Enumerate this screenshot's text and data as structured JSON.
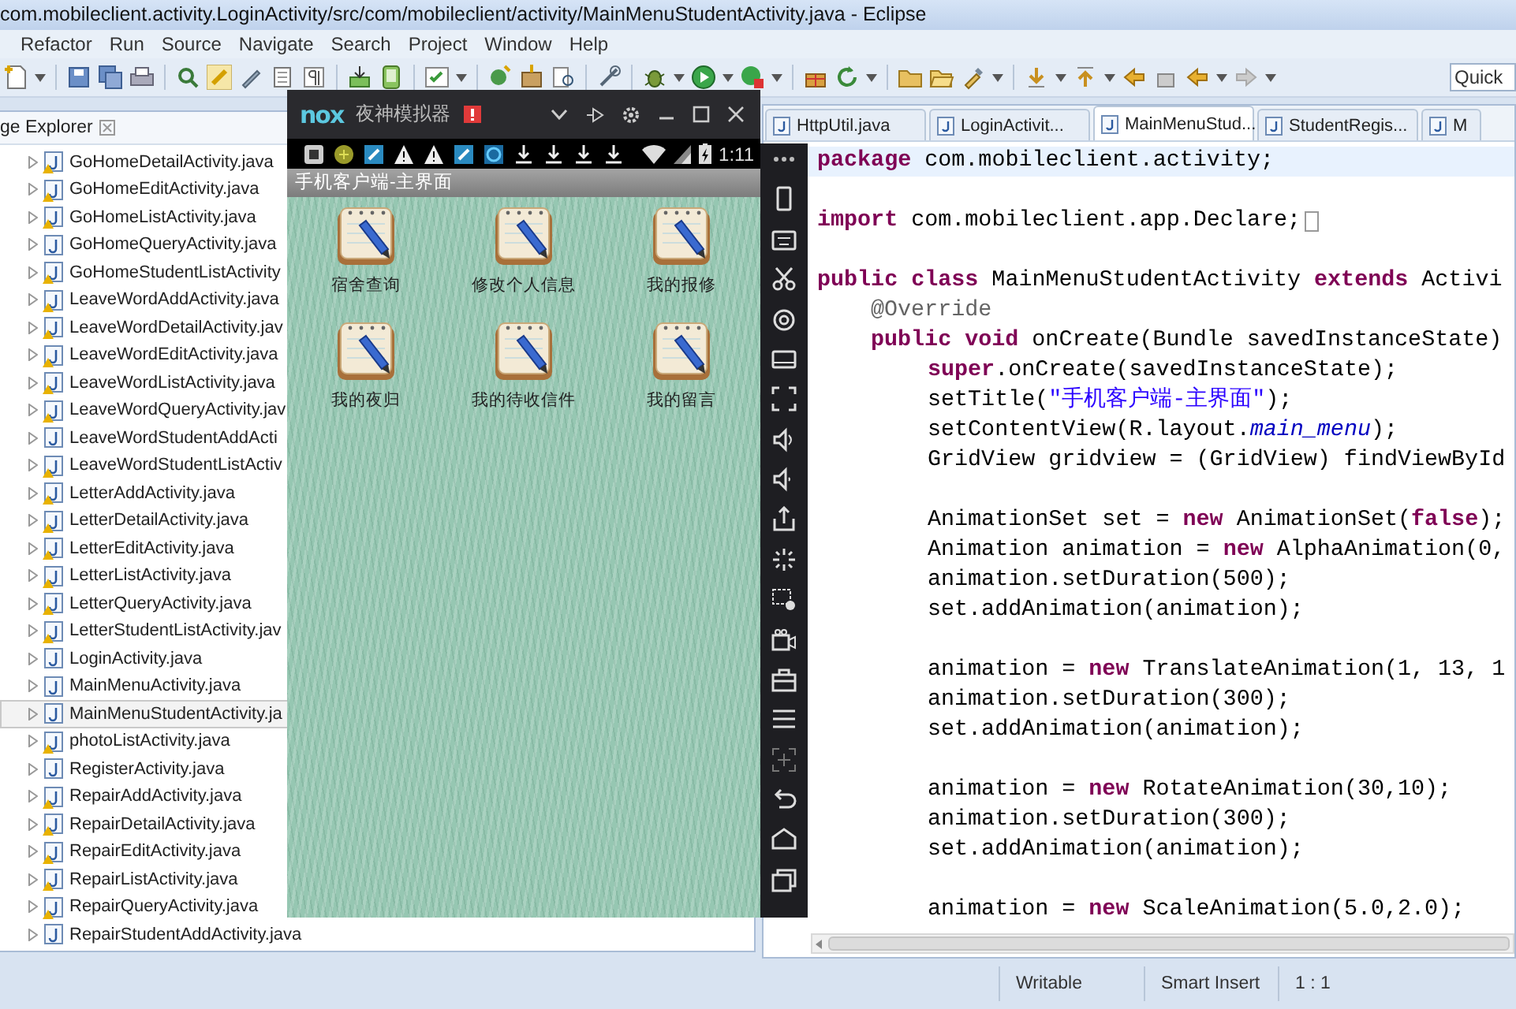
{
  "window": {
    "title": "com.mobileclient.activity.LoginActivity/src/com/mobileclient/activity/MainMenuStudentActivity.java - Eclipse"
  },
  "menu_bar": [
    "Refactor",
    "Run",
    "Source",
    "Navigate",
    "Search",
    "Project",
    "Window",
    "Help"
  ],
  "quick_access": {
    "placeholder": "Quick"
  },
  "package_explorer": {
    "title": "ge Explorer",
    "items": [
      {
        "label": "GoHomeDetailActivity.java",
        "warning": true,
        "selected": false
      },
      {
        "label": "GoHomeEditActivity.java",
        "warning": true,
        "selected": false
      },
      {
        "label": "GoHomeListActivity.java",
        "warning": true,
        "selected": false
      },
      {
        "label": "GoHomeQueryActivity.java",
        "warning": false,
        "selected": false
      },
      {
        "label": "GoHomeStudentListActivity",
        "warning": true,
        "selected": false
      },
      {
        "label": "LeaveWordAddActivity.java",
        "warning": true,
        "selected": false
      },
      {
        "label": "LeaveWordDetailActivity.jav",
        "warning": true,
        "selected": false
      },
      {
        "label": "LeaveWordEditActivity.java",
        "warning": true,
        "selected": false
      },
      {
        "label": "LeaveWordListActivity.java",
        "warning": true,
        "selected": false
      },
      {
        "label": "LeaveWordQueryActivity.jav",
        "warning": true,
        "selected": false
      },
      {
        "label": "LeaveWordStudentAddActi",
        "warning": false,
        "selected": false
      },
      {
        "label": "LeaveWordStudentListActiv",
        "warning": true,
        "selected": false
      },
      {
        "label": "LetterAddActivity.java",
        "warning": true,
        "selected": false
      },
      {
        "label": "LetterDetailActivity.java",
        "warning": true,
        "selected": false
      },
      {
        "label": "LetterEditActivity.java",
        "warning": true,
        "selected": false
      },
      {
        "label": "LetterListActivity.java",
        "warning": true,
        "selected": false
      },
      {
        "label": "LetterQueryActivity.java",
        "warning": true,
        "selected": false
      },
      {
        "label": "LetterStudentListActivity.jav",
        "warning": true,
        "selected": false
      },
      {
        "label": "LoginActivity.java",
        "warning": false,
        "selected": false
      },
      {
        "label": "MainMenuActivity.java",
        "warning": false,
        "selected": false
      },
      {
        "label": "MainMenuStudentActivity.ja",
        "warning": false,
        "selected": true
      },
      {
        "label": "photoListActivity.java",
        "warning": true,
        "selected": false
      },
      {
        "label": "RegisterActivity.java",
        "warning": false,
        "selected": false
      },
      {
        "label": "RepairAddActivity.java",
        "warning": true,
        "selected": false
      },
      {
        "label": "RepairDetailActivity.java",
        "warning": true,
        "selected": false
      },
      {
        "label": "RepairEditActivity.java",
        "warning": true,
        "selected": false
      },
      {
        "label": "RepairListActivity.java",
        "warning": true,
        "selected": false
      },
      {
        "label": "RepairQueryActivity.java",
        "warning": true,
        "selected": false
      },
      {
        "label": "RepairStudentAddActivity.java",
        "warning": false,
        "selected": false
      }
    ]
  },
  "editor": {
    "tabs": [
      {
        "label": "HttpUtil.java",
        "selected": false
      },
      {
        "label": "LoginActivit...",
        "selected": false
      },
      {
        "label": "MainMenuStud...",
        "selected": true
      },
      {
        "label": "StudentRegis...",
        "selected": false
      },
      {
        "label": "M",
        "selected": false
      }
    ],
    "lines": [
      {
        "kind": "top",
        "current": true,
        "folded": false,
        "tokens": [
          {
            "kind": "keyword",
            "text": "package"
          },
          {
            "kind": "plain",
            "text": " com.mobileclient.activity;"
          }
        ]
      },
      {
        "kind": "blank",
        "current": false,
        "folded": false
      },
      {
        "kind": "top",
        "current": false,
        "folded": true,
        "tokens": [
          {
            "kind": "keyword",
            "text": "import"
          },
          {
            "kind": "plain",
            "text": " com.mobileclient.app.Declare;"
          }
        ]
      },
      {
        "kind": "blank",
        "current": false,
        "folded": false
      },
      {
        "kind": "top",
        "current": false,
        "folded": false,
        "tokens": [
          {
            "kind": "keyword",
            "text": "public class"
          },
          {
            "kind": "plain",
            "text": " MainMenuStudentActivity "
          },
          {
            "kind": "keyword",
            "text": "extends"
          },
          {
            "kind": "plain",
            "text": " Activi"
          }
        ]
      },
      {
        "kind": "member",
        "current": false,
        "folded": false,
        "tokens": [
          {
            "kind": "annotation",
            "text": "@Override"
          }
        ]
      },
      {
        "kind": "member",
        "current": false,
        "folded": false,
        "tokens": [
          {
            "kind": "keyword",
            "text": "public void"
          },
          {
            "kind": "plain",
            "text": " onCreate(Bundle savedInstanceState)"
          }
        ]
      },
      {
        "kind": "body",
        "current": false,
        "folded": false,
        "tokens": [
          {
            "kind": "keyword",
            "text": "super"
          },
          {
            "kind": "plain",
            "text": ".onCreate(savedInstanceState);"
          }
        ]
      },
      {
        "kind": "body",
        "current": false,
        "folded": false,
        "tokens": [
          {
            "kind": "plain",
            "text": "setTitle("
          },
          {
            "kind": "string",
            "text": "\"手机客户端-主界面\""
          },
          {
            "kind": "plain",
            "text": ");"
          }
        ]
      },
      {
        "kind": "body",
        "current": false,
        "folded": false,
        "tokens": [
          {
            "kind": "plain",
            "text": "setContentView(R.layout."
          },
          {
            "kind": "field",
            "text": "main_menu"
          },
          {
            "kind": "plain",
            "text": ");"
          }
        ]
      },
      {
        "kind": "body",
        "current": false,
        "folded": false,
        "tokens": [
          {
            "kind": "plain",
            "text": "GridView gridview = (GridView) findViewById"
          }
        ]
      },
      {
        "kind": "blank",
        "current": false,
        "folded": false
      },
      {
        "kind": "body",
        "current": false,
        "folded": false,
        "tokens": [
          {
            "kind": "plain",
            "text": "AnimationSet set = "
          },
          {
            "kind": "keyword",
            "text": "new"
          },
          {
            "kind": "plain",
            "text": " AnimationSet("
          },
          {
            "kind": "keyword",
            "text": "false"
          },
          {
            "kind": "plain",
            "text": ");"
          }
        ]
      },
      {
        "kind": "body",
        "current": false,
        "folded": false,
        "tokens": [
          {
            "kind": "plain",
            "text": "Animation animation = "
          },
          {
            "kind": "keyword",
            "text": "new"
          },
          {
            "kind": "plain",
            "text": " AlphaAnimation(0,"
          }
        ]
      },
      {
        "kind": "body",
        "current": false,
        "folded": false,
        "tokens": [
          {
            "kind": "plain",
            "text": "animation.setDuration(500);"
          }
        ]
      },
      {
        "kind": "body",
        "current": false,
        "folded": false,
        "tokens": [
          {
            "kind": "plain",
            "text": "set.addAnimation(animation);"
          }
        ]
      },
      {
        "kind": "blank",
        "current": false,
        "folded": false
      },
      {
        "kind": "body",
        "current": false,
        "folded": false,
        "tokens": [
          {
            "kind": "plain",
            "text": "animation = "
          },
          {
            "kind": "keyword",
            "text": "new"
          },
          {
            "kind": "plain",
            "text": " TranslateAnimation(1, 13, 1"
          }
        ]
      },
      {
        "kind": "body",
        "current": false,
        "folded": false,
        "tokens": [
          {
            "kind": "plain",
            "text": "animation.setDuration(300);"
          }
        ]
      },
      {
        "kind": "body",
        "current": false,
        "folded": false,
        "tokens": [
          {
            "kind": "plain",
            "text": "set.addAnimation(animation);"
          }
        ]
      },
      {
        "kind": "blank",
        "current": false,
        "folded": false
      },
      {
        "kind": "body",
        "current": false,
        "folded": false,
        "tokens": [
          {
            "kind": "plain",
            "text": "animation = "
          },
          {
            "kind": "keyword",
            "text": "new"
          },
          {
            "kind": "plain",
            "text": " RotateAnimation(30,10);"
          }
        ]
      },
      {
        "kind": "body",
        "current": false,
        "folded": false,
        "tokens": [
          {
            "kind": "plain",
            "text": "animation.setDuration(300);"
          }
        ]
      },
      {
        "kind": "body",
        "current": false,
        "folded": false,
        "tokens": [
          {
            "kind": "plain",
            "text": "set.addAnimation(animation);"
          }
        ]
      },
      {
        "kind": "blank",
        "current": false,
        "folded": false
      },
      {
        "kind": "body",
        "current": false,
        "folded": false,
        "tokens": [
          {
            "kind": "plain",
            "text": "animation = "
          },
          {
            "kind": "keyword",
            "text": "new"
          },
          {
            "kind": "plain",
            "text": " ScaleAnimation(5.0,2.0);"
          }
        ]
      }
    ]
  },
  "emulator": {
    "logo": "nox",
    "title": "夜神模拟器",
    "clock": "1:11",
    "app_title": "手机客户端-主界面",
    "menu": [
      {
        "label": "宿舍查询"
      },
      {
        "label": "修改个人信息"
      },
      {
        "label": "我的报修"
      },
      {
        "label": "我的夜归"
      },
      {
        "label": "我的待收信件"
      },
      {
        "label": "我的留言"
      }
    ]
  },
  "status_bar": {
    "mode": "Writable",
    "insert_mode": "Smart Insert",
    "position": "1 : 1"
  }
}
